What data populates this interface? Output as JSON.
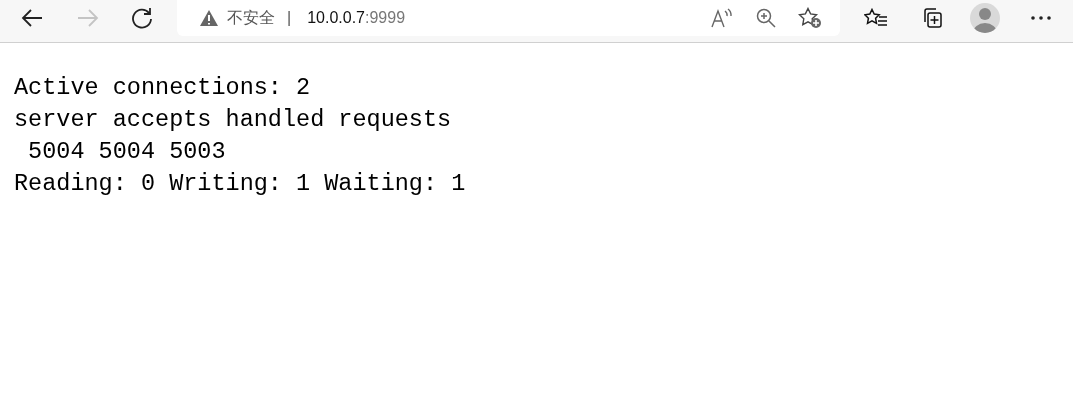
{
  "toolbar": {
    "security_label": "不安全",
    "separator": "|",
    "url_host": "10.0.0.7",
    "url_port": ":9999"
  },
  "page": {
    "lines": [
      "Active connections: 2",
      "server accepts handled requests",
      " 5004 5004 5003",
      "Reading: 0 Writing: 1 Waiting: 1"
    ]
  }
}
